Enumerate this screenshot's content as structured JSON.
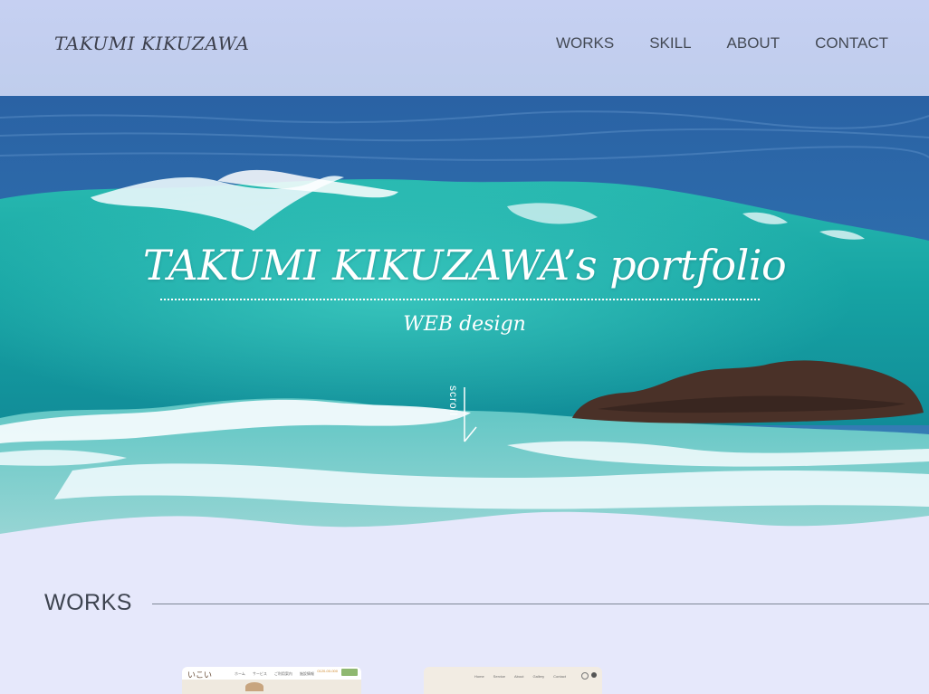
{
  "header": {
    "logo": "TAKUMI KIKUZAWA",
    "nav": [
      "WORKS",
      "SKILL",
      "ABOUT",
      "CONTACT"
    ]
  },
  "hero": {
    "title": "TAKUMI KIKUZAWA’s portfolio",
    "subtitle": "WEB design",
    "scroll_label": "scroll"
  },
  "works": {
    "title": "WORKS",
    "thumb1": {
      "logo": "いこい",
      "nav": [
        "ホーム",
        "サービス",
        "ご利用案内",
        "施設情報"
      ],
      "tel": "0120-00-000"
    },
    "thumb2": {
      "nav": [
        "Home",
        "Service",
        "About",
        "Gallery",
        "Contact"
      ]
    }
  },
  "colors": {
    "page_background": "#e6e8fb",
    "sky": "#c5cff0",
    "sea_deep": "#1f5fa3",
    "wave": "#17a7a4",
    "foam": "#f4fbff",
    "rock": "#4a3128",
    "text_dark": "#3e4450"
  }
}
